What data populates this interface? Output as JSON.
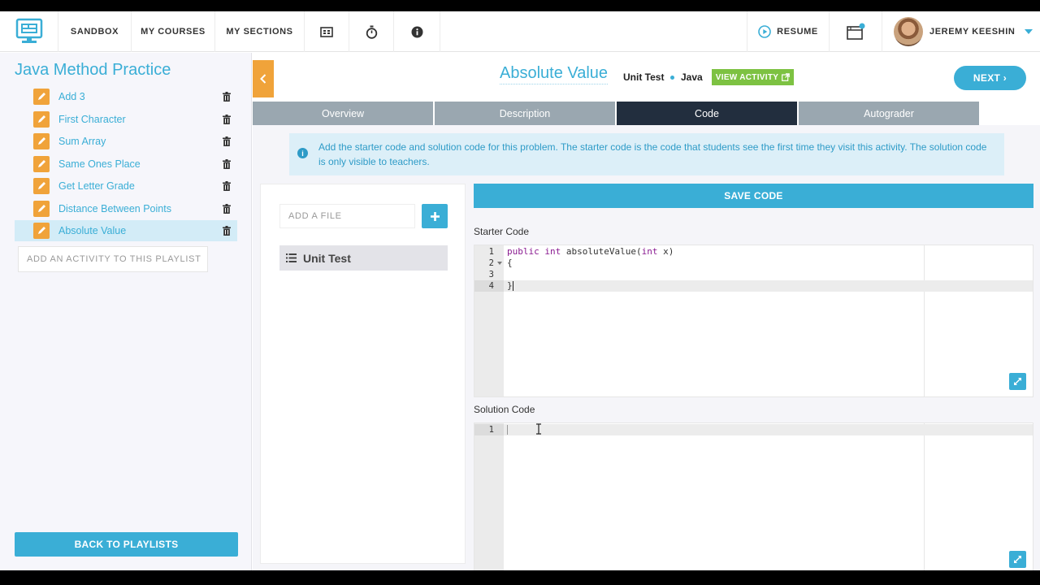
{
  "nav": {
    "items": [
      {
        "label": "SANDBOX"
      },
      {
        "label": "MY COURSES"
      },
      {
        "label": "MY SECTIONS"
      }
    ],
    "resume_label": "RESUME",
    "user_name": "JEREMY KEESHIN"
  },
  "sidebar": {
    "title": "Java Method Practice",
    "items": [
      {
        "label": "Add 3"
      },
      {
        "label": "First Character"
      },
      {
        "label": "Sum Array"
      },
      {
        "label": "Same Ones Place"
      },
      {
        "label": "Get Letter Grade"
      },
      {
        "label": "Distance Between Points"
      },
      {
        "label": "Absolute Value"
      }
    ],
    "add_activity_placeholder": "ADD AN ACTIVITY TO THIS PLAYLIST",
    "back_label": "BACK TO PLAYLISTS"
  },
  "activity": {
    "title": "Absolute Value",
    "type": "Unit Test",
    "language": "Java",
    "view_label": "VIEW ACTIVITY",
    "next_label": "NEXT ›"
  },
  "tabs": [
    {
      "label": "Overview"
    },
    {
      "label": "Description"
    },
    {
      "label": "Code"
    },
    {
      "label": "Autograder"
    }
  ],
  "info_text": "Add the starter code and solution code for this problem. The starter code is the code that students see the first time they visit this activity. The solution code is only visible to teachers.",
  "files": {
    "add_placeholder": "ADD A FILE",
    "items": [
      {
        "label": "Unit Test"
      }
    ]
  },
  "save_label": "SAVE CODE",
  "starter": {
    "label": "Starter Code",
    "line_numbers": [
      "1",
      "2",
      "3",
      "4"
    ]
  },
  "solution": {
    "label": "Solution Code",
    "line_numbers": [
      "1"
    ]
  },
  "colors": {
    "accent": "#3aaed6",
    "orange": "#f0a33a",
    "green": "#7dc242",
    "tab_active": "#222e3e",
    "tab_inactive": "#9aa7b0"
  }
}
